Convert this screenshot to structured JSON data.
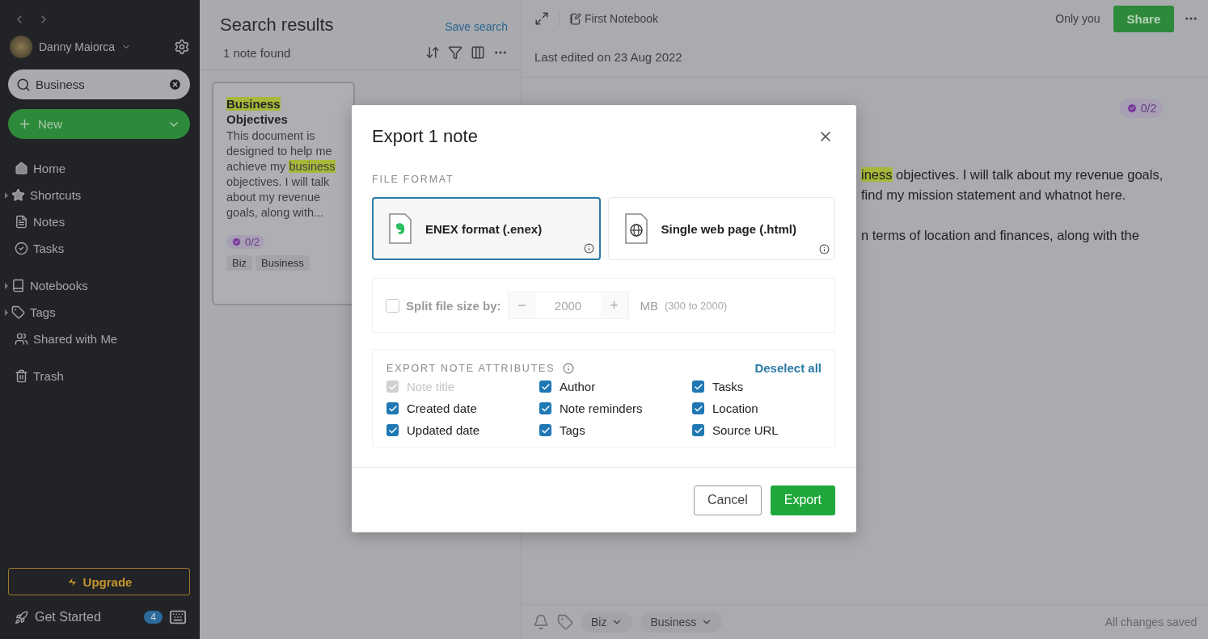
{
  "sidebar": {
    "user": {
      "name": "Danny Maiorca"
    },
    "search": {
      "value": "Business"
    },
    "new_button": {
      "label": "New"
    },
    "items": [
      {
        "label": "Home",
        "kind": "home",
        "has_caret": false
      },
      {
        "label": "Shortcuts",
        "kind": "star",
        "has_caret": true
      },
      {
        "label": "Notes",
        "kind": "note",
        "has_caret": false
      },
      {
        "label": "Tasks",
        "kind": "task",
        "has_caret": false
      },
      {
        "label": "Notebooks",
        "kind": "notebook",
        "has_caret": true
      },
      {
        "label": "Tags",
        "kind": "tag",
        "has_caret": true
      },
      {
        "label": "Shared with Me",
        "kind": "shared",
        "has_caret": false
      },
      {
        "label": "Trash",
        "kind": "trash",
        "has_caret": false
      }
    ],
    "upgrade": {
      "label": "Upgrade"
    },
    "get_started": {
      "label": "Get Started",
      "badge": "4"
    }
  },
  "note_list": {
    "title": "Search results",
    "save_search": "Save search",
    "count": "1 note found",
    "card": {
      "title": [
        {
          "text": "Business",
          "highlight": true
        },
        {
          "text": "Objectives",
          "highlight": false
        }
      ],
      "snippet": [
        {
          "text": "This document is designed to help me achieve my ",
          "highlight": false
        },
        {
          "text": "business",
          "highlight": true
        },
        {
          "text": " objectives. I will talk about my revenue goals, along with...",
          "highlight": false
        }
      ],
      "tasks": "0/2",
      "tags": [
        "Biz",
        "Business"
      ]
    }
  },
  "editor": {
    "notebook": "First Notebook",
    "sharing": "Only you",
    "share": "Share",
    "last_edited": "Last edited on 23 Aug 2022",
    "tasks": "0/2",
    "lines": [
      [
        {
          "text": "iness",
          "highlight": true
        },
        {
          "text": " objectives. I will talk about my revenue goals,",
          "highlight": false
        }
      ],
      [
        {
          "text": "find my mission statement and whatnot here.",
          "highlight": false
        }
      ],
      [
        {
          "text": "n terms of location and finances, along with the",
          "highlight": false
        }
      ]
    ],
    "tags": [
      "Biz",
      "Business"
    ],
    "status": "All changes saved"
  },
  "dialog": {
    "title": "Export 1 note",
    "file_format_label": "FILE FORMAT",
    "formats": [
      {
        "label": "ENEX format (.enex)",
        "kind": "enex",
        "selected": true
      },
      {
        "label": "Single web page (.html)",
        "kind": "html",
        "selected": false
      }
    ],
    "split": {
      "label": "Split file size by:",
      "checked": false,
      "disabled": true,
      "minus": "−",
      "value": "2000",
      "plus": "+",
      "unit": "MB",
      "range": "(300 to 2000)"
    },
    "attributes_label": "EXPORT NOTE ATTRIBUTES",
    "deselect": "Deselect all",
    "attributes": [
      {
        "label": "Note title",
        "checked": true,
        "disabled": true
      },
      {
        "label": "Author",
        "checked": true,
        "disabled": false
      },
      {
        "label": "Tasks",
        "checked": true,
        "disabled": false
      },
      {
        "label": "Created date",
        "checked": true,
        "disabled": false
      },
      {
        "label": "Note reminders",
        "checked": true,
        "disabled": false
      },
      {
        "label": "Location",
        "checked": true,
        "disabled": false
      },
      {
        "label": "Updated date",
        "checked": true,
        "disabled": false
      },
      {
        "label": "Tags",
        "checked": true,
        "disabled": false
      },
      {
        "label": "Source URL",
        "checked": true,
        "disabled": false
      }
    ],
    "cancel": "Cancel",
    "export": "Export"
  }
}
